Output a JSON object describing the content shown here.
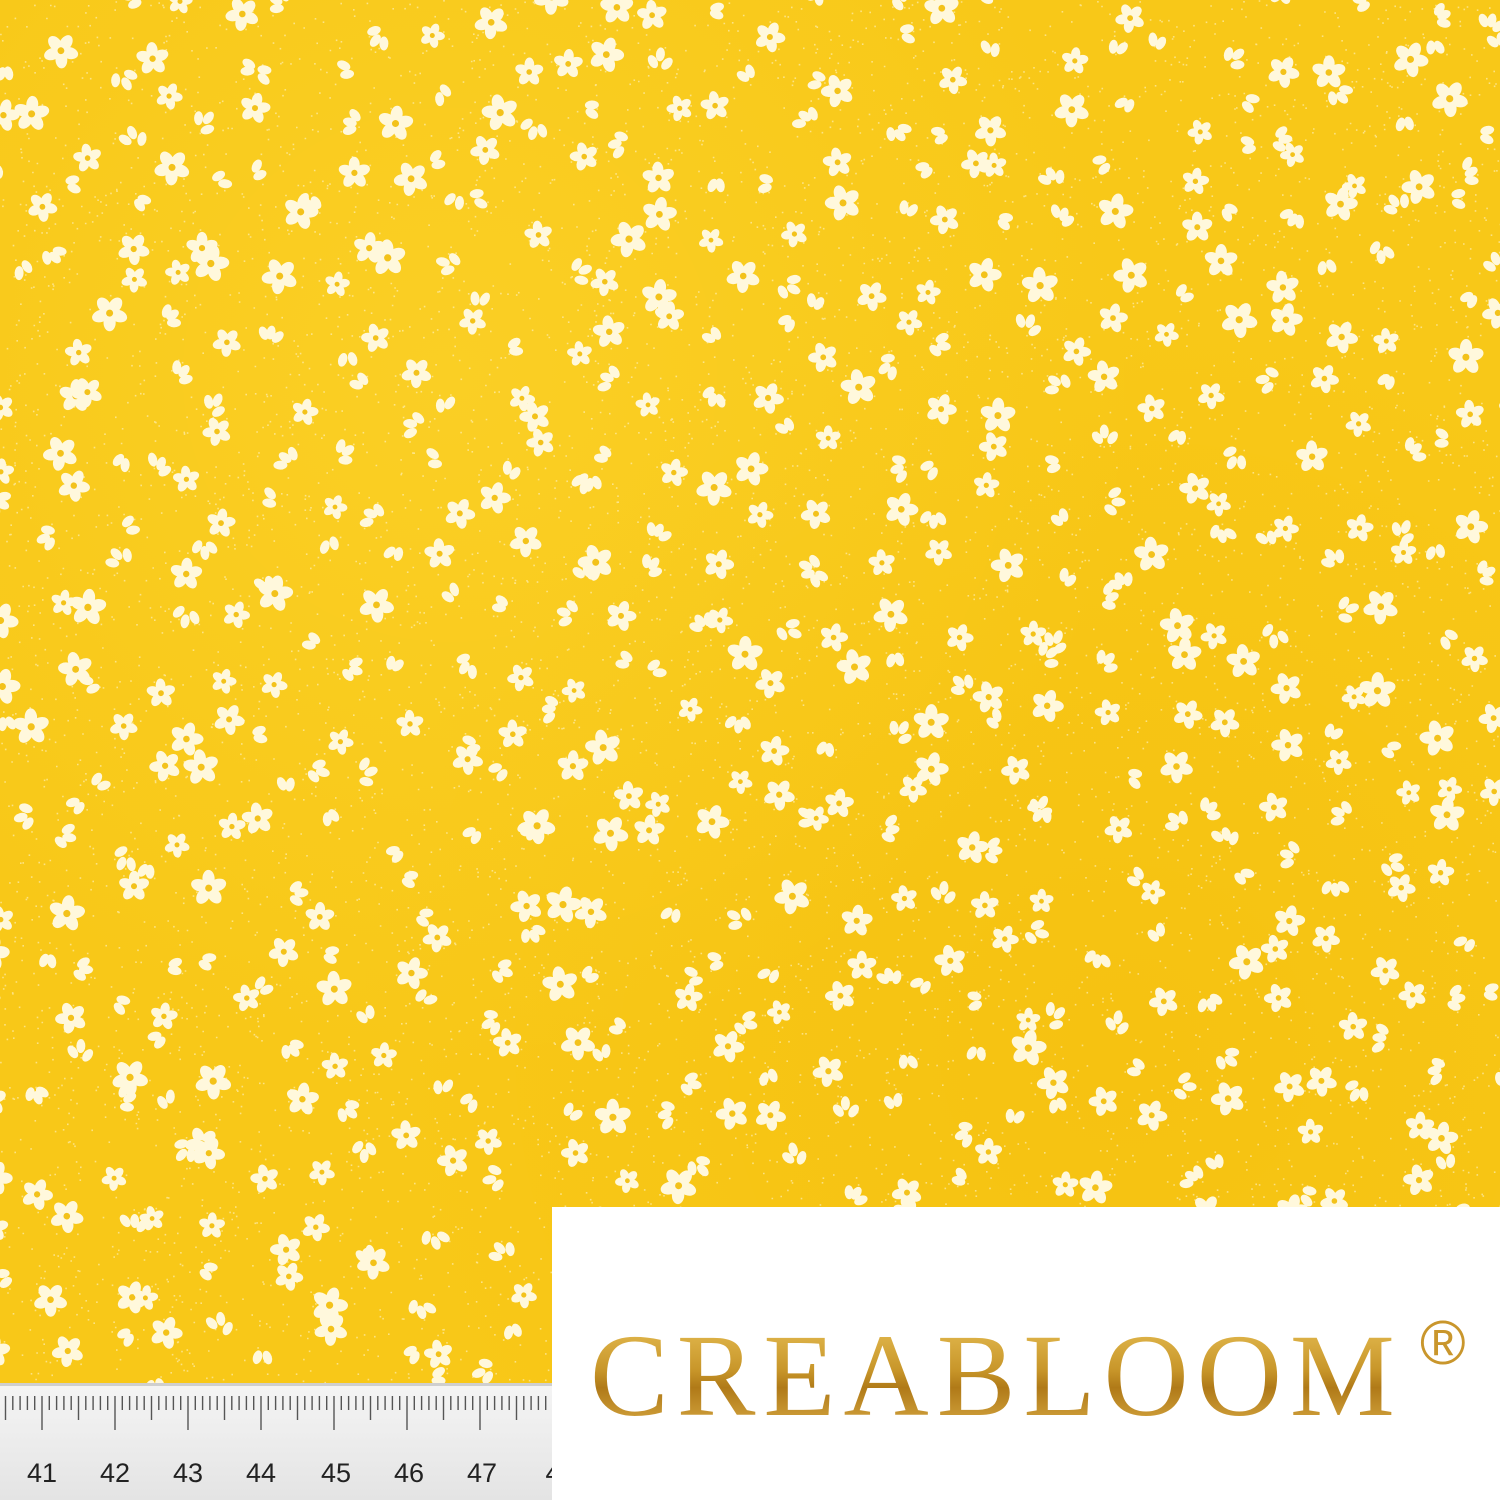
{
  "image": {
    "subject": "yellow cotton fabric with small white ditsy flower print",
    "colors": {
      "fabric": "#f8c818",
      "print": "#fff8dc",
      "ruler": "#eeeeee",
      "panel": "#ffffff",
      "brand_gold": "#c8962a"
    }
  },
  "ruler": {
    "numbers": [
      "41",
      "42",
      "43",
      "44",
      "45",
      "46",
      "47",
      "4"
    ]
  },
  "brand": {
    "name": "CREABLOOM",
    "mark": "®"
  }
}
